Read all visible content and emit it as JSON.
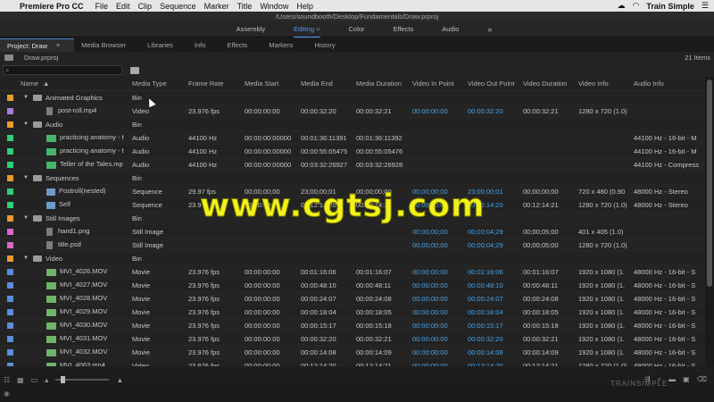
{
  "menubar": {
    "apple": "",
    "app": "Premiere Pro CC",
    "items": [
      "File",
      "Edit",
      "Clip",
      "Sequence",
      "Marker",
      "Title",
      "Window",
      "Help"
    ],
    "brand": "Train Simple"
  },
  "title": "/Users/soundbooth/Desktop/Fundamentals/Draw.prproj",
  "workspaces": {
    "items": [
      "Assembly",
      "Editing",
      "Color",
      "Effects",
      "Audio"
    ],
    "active": "Editing",
    "more": "»"
  },
  "tabs": [
    "Project: Draw",
    "Media Browser",
    "Libraries",
    "Info",
    "Effects",
    "Markers",
    "History"
  ],
  "project": {
    "file": "Draw.prproj",
    "count": "21 Items",
    "search_icon": "⌕"
  },
  "columns": [
    "Name",
    "Media Type",
    "Frame Rate",
    "Media Start",
    "Media End",
    "Media Duration",
    "Video In Point",
    "Video Out Point",
    "Video Duration",
    "Video Info",
    "Audio Info"
  ],
  "rows": [
    {
      "label_color": "#e79b2b",
      "kind": "bin",
      "indent": 0,
      "name": "Animated Graphics",
      "type": "Bin",
      "fr": "",
      "ms": "",
      "me": "",
      "md": "",
      "vi": "",
      "vo": "",
      "vd": "",
      "vinfo": "",
      "ainfo": ""
    },
    {
      "label_color": "#a97ed6",
      "kind": "file",
      "indent": 1,
      "name": "post-roll.mp4",
      "type": "Video",
      "fr": "23.976 fps",
      "ms": "00:00:00:00",
      "me": "00:00:32:20",
      "md": "00:00:32:21",
      "vi": "00:00:00:00",
      "vo": "00:00:32:20",
      "vd": "00:00:32:21",
      "vinfo": "1280 x 720 (1.0)",
      "ainfo": ""
    },
    {
      "label_color": "#e79b2b",
      "kind": "bin",
      "indent": 0,
      "name": "Audio",
      "type": "Bin",
      "fr": "",
      "ms": "",
      "me": "",
      "md": "",
      "vi": "",
      "vo": "",
      "vd": "",
      "vinfo": "",
      "ainfo": ""
    },
    {
      "label_color": "#2fcf7a",
      "kind": "audio",
      "indent": 1,
      "name": "practicing anatomy - t",
      "type": "Audio",
      "fr": "44100 Hz",
      "ms": "00:00:00:00000",
      "me": "00:01:36:11391",
      "md": "00:01:36:11392",
      "vi": "",
      "vo": "",
      "vd": "",
      "vinfo": "",
      "ainfo": "44100 Hz - 16-bit - M"
    },
    {
      "label_color": "#2fcf7a",
      "kind": "audio",
      "indent": 1,
      "name": "practicing anatomy - t",
      "type": "Audio",
      "fr": "44100 Hz",
      "ms": "00:00:00:00000",
      "me": "00:00:55:05475",
      "md": "00:00:55:05476",
      "vi": "",
      "vo": "",
      "vd": "",
      "vinfo": "",
      "ainfo": "44100 Hz - 16-bit - M"
    },
    {
      "label_color": "#2fcf7a",
      "kind": "audio",
      "indent": 1,
      "name": "Teller of the Tales.mp",
      "type": "Audio",
      "fr": "44100 Hz",
      "ms": "00:00:00:00000",
      "me": "00:03:32:26927",
      "md": "00:03:32:26928",
      "vi": "",
      "vo": "",
      "vd": "",
      "vinfo": "",
      "ainfo": "44100 Hz - Compress"
    },
    {
      "label_color": "#e79b2b",
      "kind": "bin",
      "indent": 0,
      "name": "Sequences",
      "type": "Bin",
      "fr": "",
      "ms": "",
      "me": "",
      "md": "",
      "vi": "",
      "vo": "",
      "vd": "",
      "vinfo": "",
      "ainfo": ""
    },
    {
      "label_color": "#2fcf7a",
      "kind": "seq",
      "indent": 1,
      "name": "Postroll(nested)",
      "type": "Sequence",
      "fr": "29.97 fps",
      "ms": "00;00;00;00",
      "me": "23;00;00;01",
      "md": "00;00;00;00",
      "vi": "00;00;00;00",
      "vo": "23;00;00;01",
      "vd": "00;00;00;00",
      "vinfo": "720 x 480 (0.90",
      "ainfo": "48000 Hz - Stereo"
    },
    {
      "label_color": "#2fcf7a",
      "kind": "seq",
      "indent": 1,
      "name": "Self",
      "type": "Sequence",
      "fr": "23.976 fps",
      "ms": "00:00:00:00",
      "me": "00:12:14:20",
      "md": "00:12:14:21",
      "vi": "00:00:00:00",
      "vo": "00:12:14:20",
      "vd": "00:12:14:21",
      "vinfo": "1280 x 720 (1.0)",
      "ainfo": "48000 Hz - Stereo"
    },
    {
      "label_color": "#e79b2b",
      "kind": "bin",
      "indent": 0,
      "name": "Still Images",
      "type": "Bin",
      "fr": "",
      "ms": "",
      "me": "",
      "md": "",
      "vi": "",
      "vo": "",
      "vd": "",
      "vinfo": "",
      "ainfo": ""
    },
    {
      "label_color": "#d567c8",
      "kind": "file",
      "indent": 1,
      "name": "hand1.png",
      "type": "Still Image",
      "fr": "",
      "ms": "",
      "me": "",
      "md": "",
      "vi": "00;00;00;00",
      "vo": "00;00;04;29",
      "vd": "00;00;05;00",
      "vinfo": "401 x 405 (1.0)",
      "ainfo": ""
    },
    {
      "label_color": "#d567c8",
      "kind": "file",
      "indent": 1,
      "name": "title.psd",
      "type": "Still Image",
      "fr": "",
      "ms": "",
      "me": "",
      "md": "",
      "vi": "00;00;00;00",
      "vo": "00;00;04;29",
      "vd": "00;00;05;00",
      "vinfo": "1280 x 720 (1.0)",
      "ainfo": ""
    },
    {
      "label_color": "#e79b2b",
      "kind": "bin",
      "indent": 0,
      "name": "Video",
      "type": "Bin",
      "fr": "",
      "ms": "",
      "me": "",
      "md": "",
      "vi": "",
      "vo": "",
      "vd": "",
      "vinfo": "",
      "ainfo": ""
    },
    {
      "label_color": "#5a8ed8",
      "kind": "video",
      "indent": 1,
      "name": "MVI_4026.MOV",
      "type": "Movie",
      "fr": "23.976 fps",
      "ms": "00:00:00:00",
      "me": "00:01:16:06",
      "md": "00:01:16:07",
      "vi": "00:00:00:00",
      "vo": "00:01:16:06",
      "vd": "00:01:16:07",
      "vinfo": "1920 x 1080 (1.",
      "ainfo": "48000 Hz - 16-bit - S"
    },
    {
      "label_color": "#5a8ed8",
      "kind": "video",
      "indent": 1,
      "name": "MVI_4027.MOV",
      "type": "Movie",
      "fr": "23.976 fps",
      "ms": "00:00:00:00",
      "me": "00:00:48:10",
      "md": "00:00:48:11",
      "vi": "00:00:00:00",
      "vo": "00:00:48:10",
      "vd": "00:00:48:11",
      "vinfo": "1920 x 1080 (1.",
      "ainfo": "48000 Hz - 16-bit - S"
    },
    {
      "label_color": "#5a8ed8",
      "kind": "video",
      "indent": 1,
      "name": "MVI_4028.MOV",
      "type": "Movie",
      "fr": "23.976 fps",
      "ms": "00:00:00:00",
      "me": "00:00:24:07",
      "md": "00:00:24:08",
      "vi": "00:00:00:00",
      "vo": "00:00:24:07",
      "vd": "00:00:24:08",
      "vinfo": "1920 x 1080 (1.",
      "ainfo": "48000 Hz - 16-bit - S"
    },
    {
      "label_color": "#5a8ed8",
      "kind": "video",
      "indent": 1,
      "name": "MVI_4029.MOV",
      "type": "Movie",
      "fr": "23.976 fps",
      "ms": "00:00:00:00",
      "me": "00:00:18:04",
      "md": "00:00:18:05",
      "vi": "00:00:00:00",
      "vo": "00:00:18:04",
      "vd": "00:00:18:05",
      "vinfo": "1920 x 1080 (1.",
      "ainfo": "48000 Hz - 16-bit - S"
    },
    {
      "label_color": "#5a8ed8",
      "kind": "video",
      "indent": 1,
      "name": "MVI_4030.MOV",
      "type": "Movie",
      "fr": "23.976 fps",
      "ms": "00:00:00:00",
      "me": "00:00:15:17",
      "md": "00:00:15:18",
      "vi": "00:00:00:00",
      "vo": "00:00:15:17",
      "vd": "00:00:15:18",
      "vinfo": "1920 x 1080 (1.",
      "ainfo": "48000 Hz - 16-bit - S"
    },
    {
      "label_color": "#5a8ed8",
      "kind": "video",
      "indent": 1,
      "name": "MVI_4031.MOV",
      "type": "Movie",
      "fr": "23.976 fps",
      "ms": "00:00:00:00",
      "me": "00:00:32:20",
      "md": "00:00:32:21",
      "vi": "00:00:00:00",
      "vo": "00:00:32:20",
      "vd": "00:00:32:21",
      "vinfo": "1920 x 1080 (1.",
      "ainfo": "48000 Hz - 16-bit - S"
    },
    {
      "label_color": "#5a8ed8",
      "kind": "video",
      "indent": 1,
      "name": "MVI_4032.MOV",
      "type": "Movie",
      "fr": "23.976 fps",
      "ms": "00:00:00:00",
      "me": "00:00:14:08",
      "md": "00:00:14:09",
      "vi": "00:00:00:00",
      "vo": "00:00:14:08",
      "vd": "00:00:14:09",
      "vinfo": "1920 x 1080 (1.",
      "ainfo": "48000 Hz - 16-bit - S"
    },
    {
      "label_color": "#5a8ed8",
      "kind": "video",
      "indent": 1,
      "name": "MVI_4063.mp4",
      "type": "Video",
      "fr": "23.976 fps",
      "ms": "00:00:00:00",
      "me": "00:12:14:20",
      "md": "00:12:14:21",
      "vi": "00:00:00:00",
      "vo": "00:12:14:20",
      "vd": "00:12:14:21",
      "vinfo": "1280 x 720 (1.0)",
      "ainfo": "48000 Hz - 16-bit - S"
    }
  ],
  "watermark": "www.cgtsj.com",
  "brandmark": "TRAINSIMPLE"
}
